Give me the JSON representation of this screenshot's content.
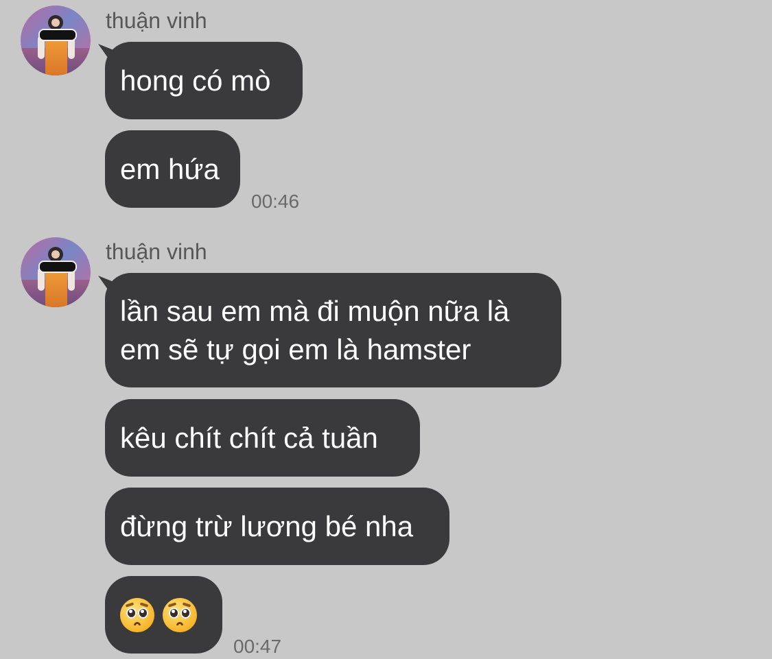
{
  "colors": {
    "background": "#c8c8c8",
    "bubble": "#3a3a3c",
    "bubble_text": "#ffffff",
    "sender_text": "#575757",
    "time_text": "#6a6a6a"
  },
  "groups": [
    {
      "sender": "thuận vinh",
      "avatar_icon": "user-avatar",
      "messages": [
        {
          "lines": [
            "hong có mò"
          ]
        },
        {
          "lines": [
            "em hứa"
          ]
        }
      ],
      "time": "00:46"
    },
    {
      "sender": "thuận vinh",
      "avatar_icon": "user-avatar",
      "messages": [
        {
          "lines": [
            "lần sau em mà đi muộn nữa là",
            "em sẽ tự gọi em là hamster"
          ]
        },
        {
          "lines": [
            "kêu chít chít cả tuần"
          ]
        },
        {
          "lines": [
            "đừng trừ lương bé nha"
          ]
        },
        {
          "lines": [
            "🥺🥺"
          ],
          "emoji": [
            "pleading-face-emoji",
            "pleading-face-emoji"
          ]
        }
      ],
      "time": "00:47"
    }
  ]
}
